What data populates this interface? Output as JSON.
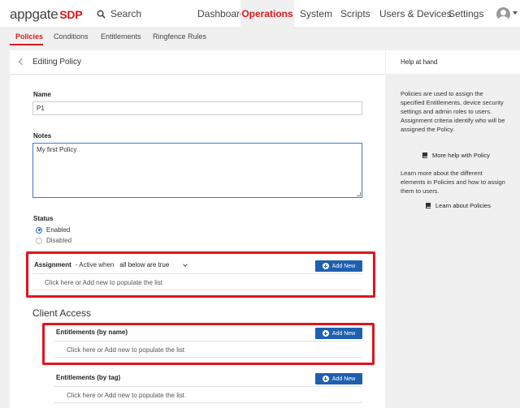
{
  "brand": {
    "name": "appgate",
    "suffix": "SDP"
  },
  "search": {
    "label": "Search"
  },
  "nav": {
    "dashboard": "Dashboard",
    "operations": "Operations",
    "system": "System",
    "scripts": "Scripts",
    "users": "Users & Devices",
    "settings": "Settings"
  },
  "subnav": {
    "policies": "Policies",
    "conditions": "Conditions",
    "entitlements": "Entitlements",
    "ringfence": "Ringfence Rules"
  },
  "panel": {
    "title": "Editing Policy",
    "name_label": "Name",
    "name_value": "P1",
    "notes_label": "Notes",
    "notes_value": "My first Policy",
    "status_label": "Status",
    "status_enabled": "Enabled",
    "status_disabled": "Disabled",
    "assignment_label": "Assignment",
    "assignment_active": "- Active when",
    "assignment_mode": "all below are true",
    "add_new": "Add New",
    "populate_hint": "Click here or Add new to populate the list",
    "client_access": "Client Access",
    "ent_by_name": "Entitlements (by name)",
    "ent_by_tag": "Entitlements (by tag)"
  },
  "help": {
    "title": "Help at hand",
    "para1": "Policies are used to assign the specified Entitlements, device security settings and admin roles to users. Assignment criteria identify who will be assigned the Policy.",
    "link1": "More help with Policy",
    "para2": "Learn more about the different elements in Policies and how to assign them to users.",
    "link2": "Learn about Policies"
  },
  "colors": {
    "accent_red": "#d71920",
    "button_blue": "#1f5fb0",
    "highlight_red": "#e0141d"
  }
}
